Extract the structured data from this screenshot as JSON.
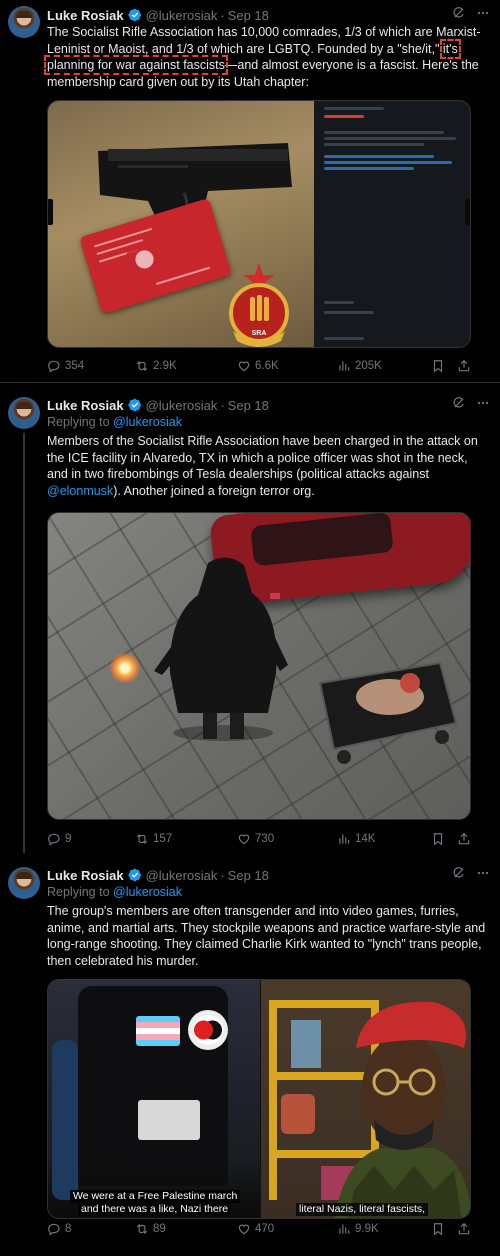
{
  "tweets": [
    {
      "name": "Luke Rosiak",
      "handle": "@lukerosiak",
      "dot": "·",
      "date": "Sep 18",
      "body_pre": "The Socialist Rifle Association has 10,000 comrades, 1/3 of which are Marxist-Leninist or Maoist, and 1/3 of which are LGBTQ. Founded by a \"she/it,\" ",
      "body_highlight": "it's planning for war against fascists",
      "body_post": "—and almost everyone is a fascist. Here's the membership card given out by its Utah chapter:",
      "media_emblem_text": "SRA",
      "stats": {
        "replies": "354",
        "reposts": "2.9K",
        "likes": "6.6K",
        "views": "205K"
      }
    },
    {
      "name": "Luke Rosiak",
      "handle": "@lukerosiak",
      "dot": "·",
      "date": "Sep 18",
      "replying_label": "Replying to",
      "replying_handle": "@lukerosiak",
      "body_pre": "Members of the Socialist Rifle Association have been charged in the attack on the ICE facility in Alvaredo, TX in which a police officer was shot in the neck, and in two firebombings of Tesla dealerships (political attacks against ",
      "body_mention": "@elonmusk",
      "body_post": "). Another joined a foreign terror org.",
      "stats": {
        "replies": "9",
        "reposts": "157",
        "likes": "730",
        "views": "14K"
      }
    },
    {
      "name": "Luke Rosiak",
      "handle": "@lukerosiak",
      "dot": "·",
      "date": "Sep 18",
      "replying_label": "Replying to",
      "replying_handle": "@lukerosiak",
      "body": "The group's members are often transgender and into video games, furries, anime, and martial arts. They stockpile weapons and practice warfare-style and long-range shooting. They claimed Charlie Kirk wanted to \"lynch\" trans people, then celebrated his murder.",
      "caption_left_1": "We were at a Free Palestine march",
      "caption_left_2": "and there was a like, Nazi there",
      "caption_right": "literal Nazis, literal fascists,",
      "stats": {
        "replies": "8",
        "reposts": "89",
        "likes": "470",
        "views": "9.9K"
      }
    }
  ],
  "icons": {
    "verified": "verified-badge-icon",
    "grok": "grok-icon",
    "more": "more-icon",
    "reply": "reply-icon",
    "repost": "repost-icon",
    "like": "like-icon",
    "views": "views-icon",
    "bookmark": "bookmark-icon",
    "share": "share-icon"
  },
  "colors": {
    "background": "#000000",
    "text": "#e7e9ea",
    "secondary": "#71767b",
    "link": "#1d9bf0",
    "highlight_box": "#e5432c"
  }
}
